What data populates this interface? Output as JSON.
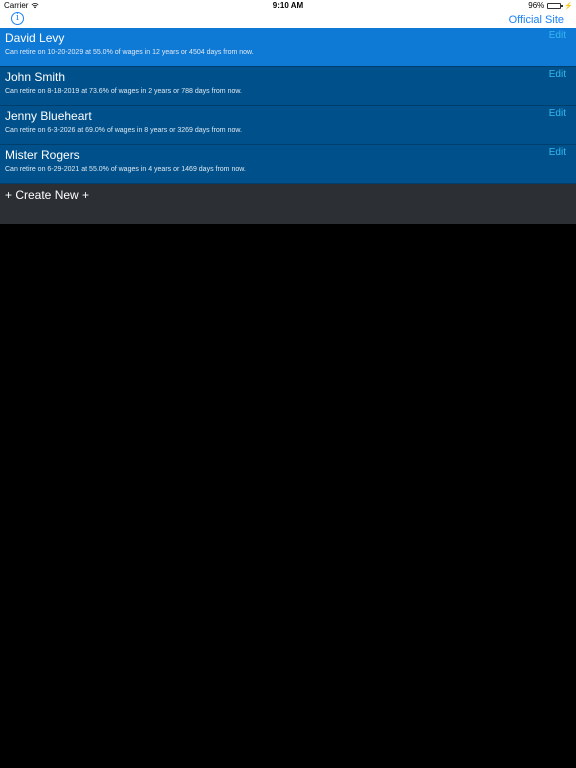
{
  "status_bar": {
    "carrier": "Carrier",
    "time": "9:10 AM",
    "battery_percent": "96%",
    "battery_level": 0.96,
    "wifi_icon": "wifi-icon",
    "charge_icon": "charging-bolt-icon"
  },
  "nav": {
    "info_icon_glyph": "i",
    "official_site_label": "Official Site"
  },
  "colors": {
    "accent": "#1a82f7",
    "selected_row": "#0f7ad6",
    "row": "#00518b",
    "edit_text": "#35b8ef",
    "create_row": "#2c2f33"
  },
  "people": [
    {
      "name": "David Levy",
      "detail": "Can retire on 10-20-2029 at 55.0% of wages in 12 years or 4504 days from now.",
      "edit_label": "Edit",
      "selected": true
    },
    {
      "name": "John Smith",
      "detail": "Can retire on 8-18-2019 at 73.6% of wages in 2 years or 788 days from now.",
      "edit_label": "Edit",
      "selected": false
    },
    {
      "name": "Jenny Blueheart",
      "detail": "Can retire on 6-3-2026 at 69.0% of wages in 8 years or 3269 days from now.",
      "edit_label": "Edit",
      "selected": false
    },
    {
      "name": "Mister Rogers",
      "detail": "Can retire on 6-29-2021 at 55.0% of wages in 4 years or 1469 days from now.",
      "edit_label": "Edit",
      "selected": false
    }
  ],
  "create_new_label": "+ Create New +"
}
